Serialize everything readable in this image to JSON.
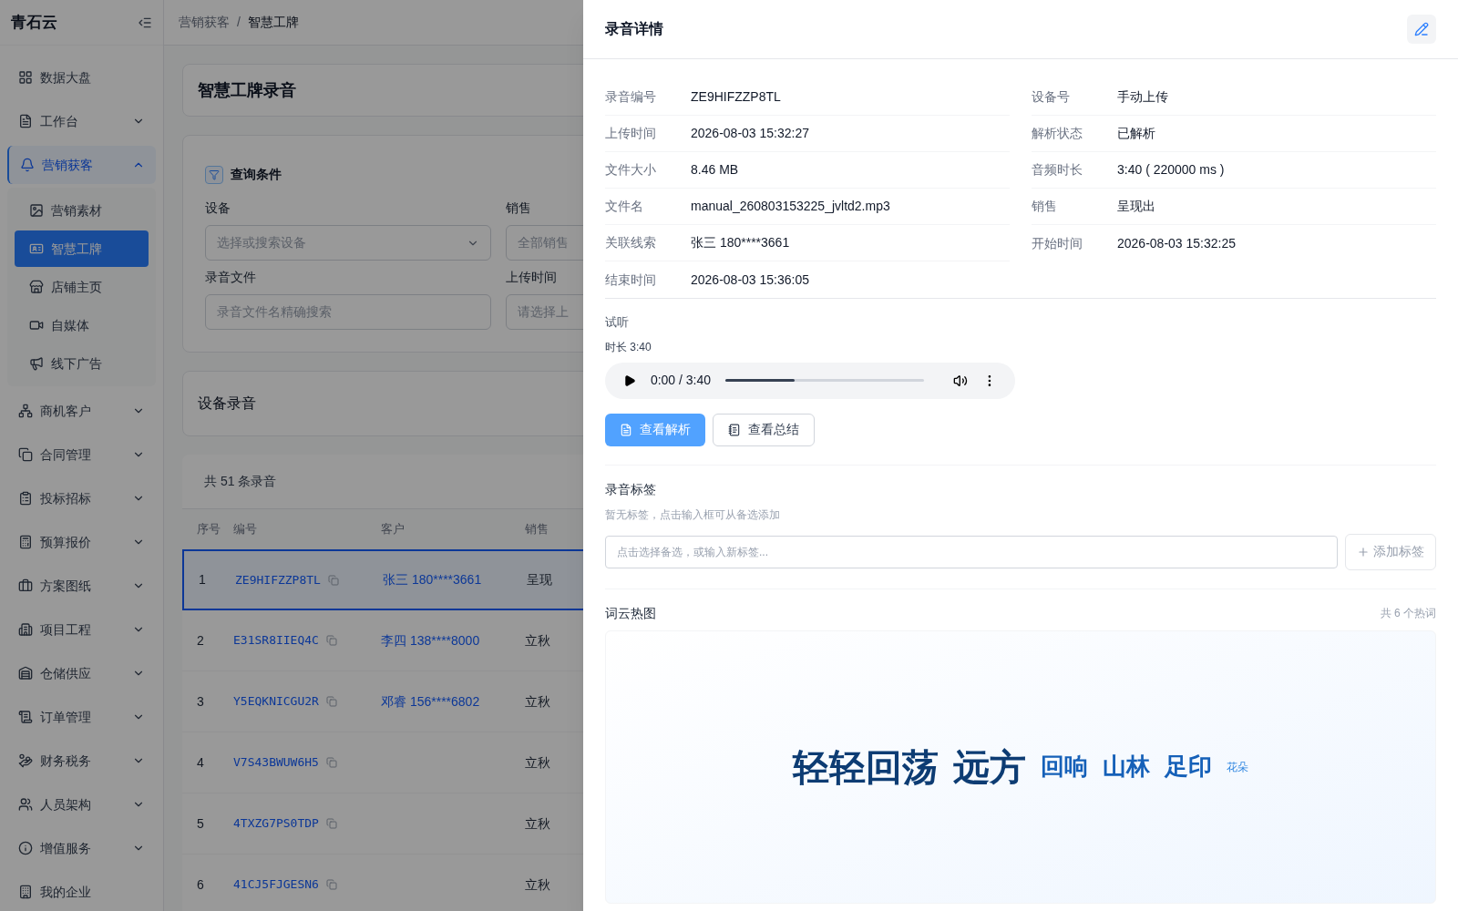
{
  "sidebar": {
    "logo": "青石云",
    "items": [
      {
        "label": "数据大盘",
        "kind": "link"
      },
      {
        "label": "工作台",
        "kind": "group",
        "expanded": false
      },
      {
        "label": "营销获客",
        "kind": "group",
        "expanded": true,
        "children": [
          {
            "label": "营销素材",
            "selected": false
          },
          {
            "label": "智慧工牌",
            "selected": true
          },
          {
            "label": "店铺主页",
            "selected": false
          },
          {
            "label": "自媒体",
            "selected": false
          },
          {
            "label": "线下广告",
            "selected": false
          }
        ]
      },
      {
        "label": "商机客户",
        "kind": "group",
        "expanded": false
      },
      {
        "label": "合同管理",
        "kind": "group",
        "expanded": false
      },
      {
        "label": "投标招标",
        "kind": "group",
        "expanded": false
      },
      {
        "label": "预算报价",
        "kind": "group",
        "expanded": false
      },
      {
        "label": "方案图纸",
        "kind": "group",
        "expanded": false
      },
      {
        "label": "项目工程",
        "kind": "group",
        "expanded": false
      },
      {
        "label": "仓储供应",
        "kind": "group",
        "expanded": false
      },
      {
        "label": "订单管理",
        "kind": "group",
        "expanded": false
      },
      {
        "label": "财务税务",
        "kind": "group",
        "expanded": false
      },
      {
        "label": "人员架构",
        "kind": "group",
        "expanded": false
      },
      {
        "label": "增值服务",
        "kind": "group",
        "expanded": false
      },
      {
        "label": "我的企业",
        "kind": "link"
      }
    ]
  },
  "breadcrumb": [
    "营销获客",
    "/",
    "智慧工牌"
  ],
  "page_title": "智慧工牌录音",
  "filters": {
    "title": "查询条件",
    "fields": [
      {
        "label": "设备",
        "placeholder": "选择或搜索设备",
        "kind": "select"
      },
      {
        "label": "销售",
        "placeholder": "全部销售",
        "kind": "select"
      },
      {
        "label": "录音文件",
        "placeholder": "录音文件名精确搜索",
        "kind": "input"
      },
      {
        "label": "上传时间",
        "placeholder": "请选择上",
        "kind": "input"
      }
    ]
  },
  "recordings": {
    "title": "设备录音",
    "count": "共 51 条录音",
    "columns": [
      "序号",
      "编号",
      "客户",
      "销售"
    ],
    "rows": [
      {
        "index": "1",
        "code": "ZE9HIFZZP8TL",
        "customer": "张三 180****3661",
        "sales": "呈现",
        "selected": true
      },
      {
        "index": "2",
        "code": "E31SR8IIEQ4C",
        "customer": "李四 138****8000",
        "sales": "立秋",
        "selected": false
      },
      {
        "index": "3",
        "code": "Y5EQKNICGU2R",
        "customer": "邓睿 156****6802",
        "sales": "立秋",
        "selected": false
      },
      {
        "index": "4",
        "code": "V7S43BWUW6H5",
        "sales": "立秋",
        "selected": false
      },
      {
        "index": "5",
        "code": "4TXZG7PS0TDP",
        "sales": "立秋",
        "selected": false
      },
      {
        "index": "6",
        "code": "41CJ5FJGESN6",
        "sales": "立秋",
        "selected": false
      }
    ]
  },
  "drawer": {
    "title": "录音详情",
    "details": [
      {
        "label": "录音编号",
        "value": "ZE9HIFZZP8TL"
      },
      {
        "label": "设备号",
        "value": "手动上传"
      },
      {
        "label": "上传时间",
        "value": "2026-08-03 15:32:27"
      },
      {
        "label": "解析状态",
        "value": "已解析"
      },
      {
        "label": "文件大小",
        "value": "8.46 MB"
      },
      {
        "label": "音频时长",
        "value": "3:40 ( 220000 ms )"
      },
      {
        "label": "文件名",
        "value": "manual_260803153225_jvltd2.mp3"
      },
      {
        "label": "销售",
        "value": "呈现出"
      },
      {
        "label": "关联线索",
        "value": "张三 180****3661"
      },
      {
        "label": "开始时间",
        "value": "2026-08-03 15:32:25"
      },
      {
        "label": "结束时间",
        "value": "2026-08-03 15:36:05"
      }
    ],
    "preview": {
      "title": "试听",
      "duration": "时长 3:40",
      "player": {
        "time": "0:00 / 3:40",
        "level": 0.35
      }
    },
    "actions": [
      {
        "label": "查看解析",
        "kind": "primary"
      },
      {
        "label": "查看总结",
        "kind": "default"
      }
    ],
    "tags": {
      "title": "录音标签",
      "hint": "暂无标签，点击输入框可从备选添加",
      "placeholder": "点击选择备选，或输入新标签...",
      "add": "添加标签"
    },
    "word_cloud": {
      "title": "词云热图",
      "count": "共 6 个热词",
      "words": [
        {
          "text": "轻轻回荡",
          "kind": "xl",
          "color": "#0d3c73"
        },
        {
          "text": "远方",
          "kind": "xl",
          "color": "#0d3c73"
        },
        {
          "text": "回响",
          "kind": "lg",
          "color": "#1560b8"
        },
        {
          "text": "山林",
          "kind": "lg",
          "color": "#1560b8"
        },
        {
          "text": "足印",
          "kind": "lg",
          "color": "#1560b8"
        },
        {
          "text": "花朵",
          "kind": "sm",
          "color": "#2f86e0"
        }
      ]
    }
  }
}
